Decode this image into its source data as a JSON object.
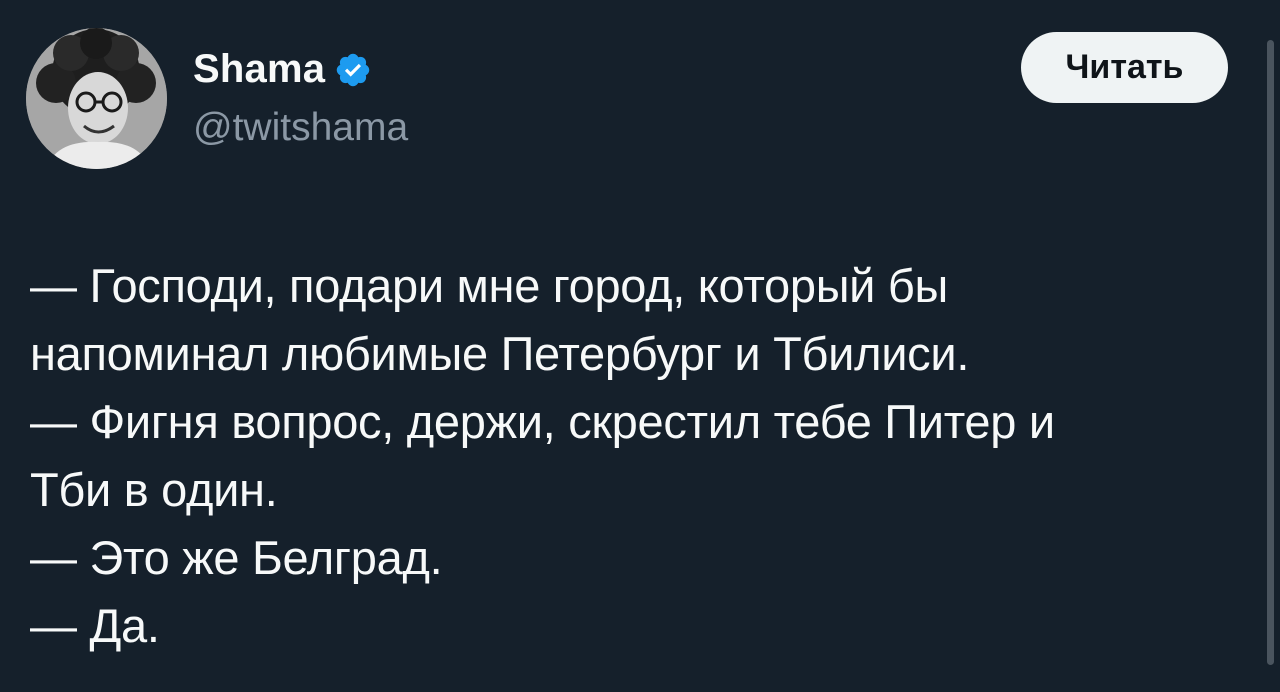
{
  "author": {
    "display_name": "Shama",
    "handle": "@twitshama",
    "verified_color": "#1d9bf0",
    "avatar": "avatar-photo"
  },
  "follow_button": {
    "label": "Читать"
  },
  "tweet": {
    "lines": [
      "— Господи, подари мне город, который бы",
      "напоминал любимые Петербург и Тбилиси.",
      "— Фигня вопрос, держи, скрестил тебе Питер и",
      "Тби в один.",
      "— Это же Белград.",
      "— Да."
    ]
  },
  "colors": {
    "background": "#15202b",
    "text": "#f7f9f9",
    "secondary_text": "#8b98a5",
    "button_bg": "#eff3f4"
  }
}
